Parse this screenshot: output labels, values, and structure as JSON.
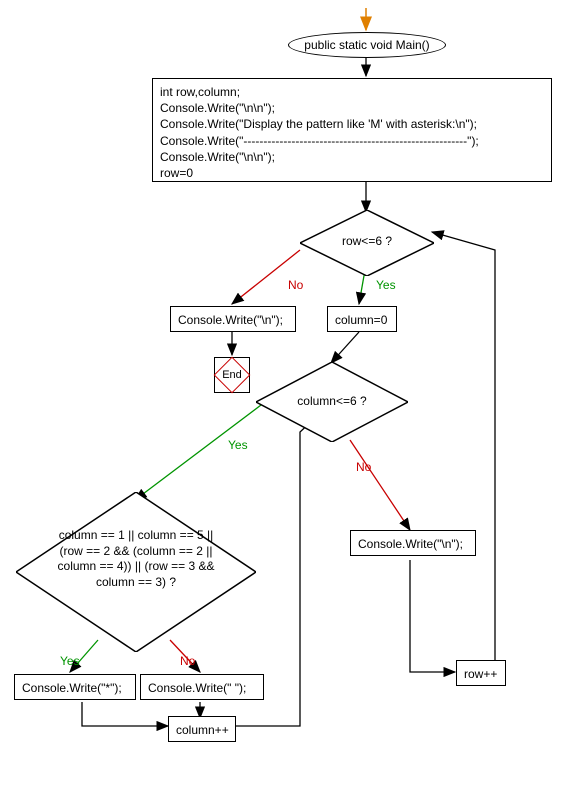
{
  "chart_data": {
    "type": "flowchart",
    "title": "",
    "nodes": [
      {
        "id": "start",
        "kind": "ellipse",
        "text": "public static void Main()"
      },
      {
        "id": "init",
        "kind": "process",
        "lines": [
          "int row,column;",
          "Console.Write(\"\\n\\n\");",
          "Console.Write(\"Display the pattern like 'M' with asterisk:\\n\");",
          "Console.Write(\"--------------------------------------------------------\");",
          "Console.Write(\"\\n\\n\");",
          "row=0"
        ]
      },
      {
        "id": "d_row",
        "kind": "decision",
        "text": "row<=6 ?"
      },
      {
        "id": "nl_outer",
        "kind": "process",
        "text": "Console.Write(\"\\n\");"
      },
      {
        "id": "end",
        "kind": "terminator",
        "text": "End"
      },
      {
        "id": "col0",
        "kind": "process",
        "text": "column=0"
      },
      {
        "id": "d_col",
        "kind": "decision",
        "text": "column<=6 ?"
      },
      {
        "id": "nl_inner",
        "kind": "process",
        "text": "Console.Write(\"\\n\");"
      },
      {
        "id": "row_inc",
        "kind": "process",
        "text": "row++"
      },
      {
        "id": "d_cond",
        "kind": "decision",
        "text": "column == 1 || column == 5 || (row == 2 && (column == 2 || column == 4)) || (row == 3 && column == 3) ?"
      },
      {
        "id": "star",
        "kind": "process",
        "text": "Console.Write(\"*\");"
      },
      {
        "id": "space",
        "kind": "process",
        "text": "Console.Write(\" \");"
      },
      {
        "id": "col_inc",
        "kind": "process",
        "text": "column++"
      }
    ],
    "edges": [
      {
        "from": "entry",
        "to": "start"
      },
      {
        "from": "start",
        "to": "init"
      },
      {
        "from": "init",
        "to": "d_row"
      },
      {
        "from": "d_row",
        "to": "nl_outer",
        "label": "No"
      },
      {
        "from": "nl_outer",
        "to": "end"
      },
      {
        "from": "d_row",
        "to": "col0",
        "label": "Yes"
      },
      {
        "from": "col0",
        "to": "d_col"
      },
      {
        "from": "d_col",
        "to": "d_cond",
        "label": "Yes"
      },
      {
        "from": "d_col",
        "to": "nl_inner",
        "label": "No"
      },
      {
        "from": "nl_inner",
        "to": "row_inc"
      },
      {
        "from": "row_inc",
        "to": "d_row"
      },
      {
        "from": "d_cond",
        "to": "star",
        "label": "Yes"
      },
      {
        "from": "d_cond",
        "to": "space",
        "label": "No"
      },
      {
        "from": "star",
        "to": "col_inc"
      },
      {
        "from": "space",
        "to": "col_inc"
      },
      {
        "from": "col_inc",
        "to": "d_col"
      }
    ]
  },
  "labels": {
    "yes": "Yes",
    "no": "No",
    "end": "End"
  }
}
